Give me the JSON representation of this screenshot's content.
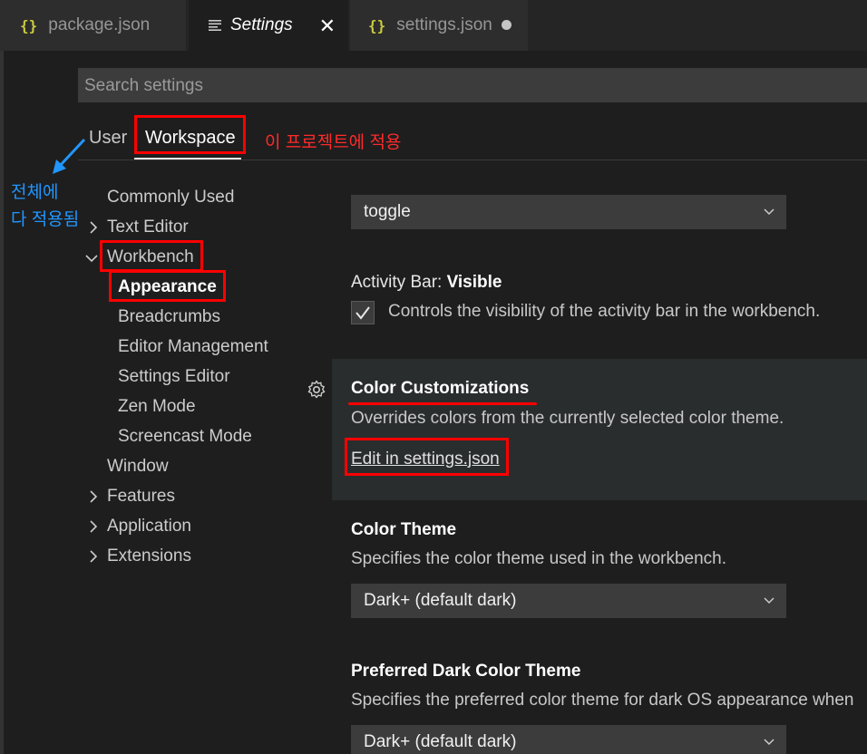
{
  "tabs": [
    {
      "label": "package.json",
      "icon": "json-braces-icon"
    },
    {
      "label": "Settings",
      "icon": "settings-lines-icon",
      "active": true
    },
    {
      "label": "settings.json",
      "icon": "json-braces-icon",
      "dirty": true
    }
  ],
  "tab_icons": {
    "braces": "{}"
  },
  "search": {
    "placeholder": "Search settings"
  },
  "scopes": {
    "user": "User",
    "workspace": "Workspace"
  },
  "annotations": {
    "workspace_note": "이 프로젝트에 적용",
    "user_note_line1": "전체에",
    "user_note_line2": "다 적용됨"
  },
  "toc": [
    {
      "label": "Commonly Used"
    },
    {
      "label": "Text Editor",
      "expandable": true
    },
    {
      "label": "Workbench",
      "expanded": true
    },
    {
      "label": "Appearance",
      "selected": true
    },
    {
      "label": "Breadcrumbs"
    },
    {
      "label": "Editor Management"
    },
    {
      "label": "Settings Editor"
    },
    {
      "label": "Zen Mode"
    },
    {
      "label": "Screencast Mode"
    },
    {
      "label": "Window"
    },
    {
      "label": "Features",
      "expandable": true
    },
    {
      "label": "Application",
      "expandable": true
    },
    {
      "label": "Extensions",
      "expandable": true
    }
  ],
  "settings": {
    "toggle_dropdown": "toggle",
    "activity_bar": {
      "prefix": "Activity Bar: ",
      "name": "Visible",
      "desc": "Controls the visibility of the activity bar in the workbench.",
      "checked": true
    },
    "color_customizations": {
      "title": "Color Customizations",
      "desc": "Overrides colors from the currently selected color theme.",
      "link": "Edit in settings.json"
    },
    "color_theme": {
      "title": "Color Theme",
      "desc": "Specifies the color theme used in the workbench.",
      "value": "Dark+ (default dark)"
    },
    "preferred_dark": {
      "title": "Preferred Dark Color Theme",
      "desc": "Specifies the preferred color theme for dark OS appearance when",
      "value": "Dark+ (default dark)"
    }
  },
  "colors": {
    "annotation_red": "#ff0000",
    "annotation_blue": "#2196ff",
    "brace_yellow": "#cbcb41"
  }
}
